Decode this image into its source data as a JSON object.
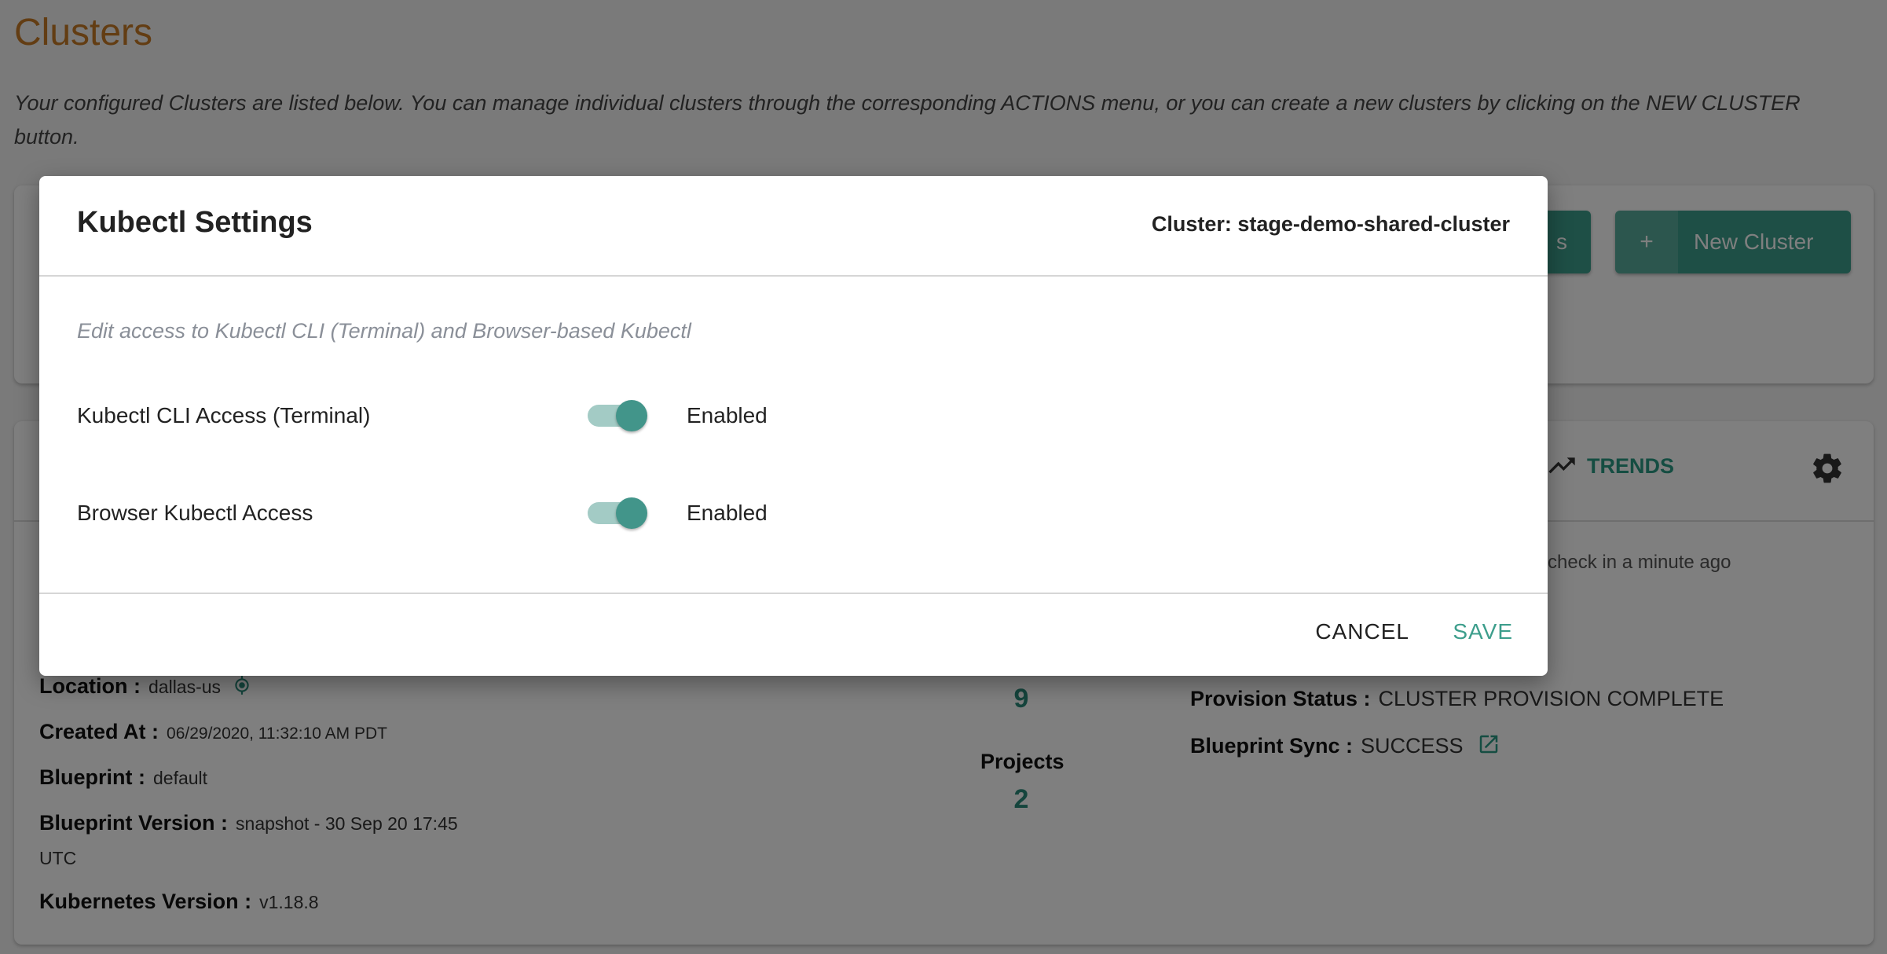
{
  "page": {
    "title": "Clusters",
    "description": "Your configured Clusters are listed below. You can manage individual clusters through the corresponding ACTIONS menu, or you can create a new clusters by clicking on the NEW CLUSTER button."
  },
  "toolbar": {
    "other_button_label": "s",
    "new_cluster_icon": "+",
    "new_cluster_label": "New Cluster"
  },
  "cluster_card": {
    "trends_label": "TRENDS",
    "trends_icon": "trending-up-icon",
    "settings_icon": "gear-icon",
    "last_check": "check in a minute ago",
    "fields": {
      "location_label": "Location :",
      "location_value": "dallas-us",
      "created_label": "Created At :",
      "created_value": "06/29/2020, 11:32:10 AM PDT",
      "blueprint_label": "Blueprint :",
      "blueprint_value": "default",
      "blueprint_version_label": "Blueprint Version :",
      "blueprint_version_value": "snapshot - 30 Sep 20 17:45",
      "blueprint_version_value_cont": "UTC",
      "k8s_version_label": "Kubernetes Version :",
      "k8s_version_value": "v1.18.8"
    },
    "stats": {
      "first_value": "9",
      "projects_label": "Projects",
      "projects_value": "2"
    },
    "status": {
      "provision_label": "Provision Status :",
      "provision_value": "CLUSTER PROVISION COMPLETE",
      "provision_color": "#1a1acc",
      "sync_label": "Blueprint Sync :",
      "sync_value": "SUCCESS",
      "sync_color": "#2a9a84"
    }
  },
  "modal": {
    "title": "Kubectl Settings",
    "cluster_label": "Cluster: stage-demo-shared-cluster",
    "subtitle": "Edit access to Kubectl CLI (Terminal) and Browser-based Kubectl",
    "settings": [
      {
        "label": "Kubectl CLI Access (Terminal)",
        "enabled": true,
        "state_label": "Enabled"
      },
      {
        "label": "Browser Kubectl Access",
        "enabled": true,
        "state_label": "Enabled"
      }
    ],
    "cancel_label": "CANCEL",
    "save_label": "SAVE",
    "accent_color": "#3d9e8c"
  }
}
